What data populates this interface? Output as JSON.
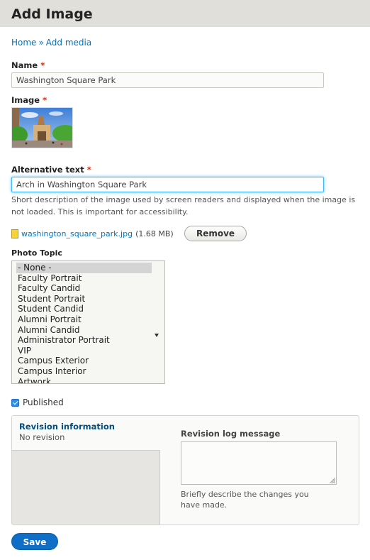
{
  "header": {
    "title": "Add Image"
  },
  "breadcrumb": {
    "items": [
      {
        "label": "Home"
      },
      {
        "label": "Add media"
      }
    ],
    "separator": "»"
  },
  "form": {
    "name": {
      "label": "Name",
      "required_mark": "*",
      "value": "Washington Square Park"
    },
    "image": {
      "label": "Image",
      "required_mark": "*",
      "thumbnail_alt": "Arch in Washington Square Park"
    },
    "alt_text": {
      "label": "Alternative text",
      "required_mark": "*",
      "value": "Arch in Washington Square Park",
      "description": "Short description of the image used by screen readers and displayed when the image is not loaded. This is important for accessibility."
    },
    "file": {
      "filename": "washington_square_park.jpg",
      "size": "(1.68 MB)",
      "remove_label": "Remove"
    },
    "photo_topic": {
      "label": "Photo Topic",
      "options": [
        "- None -",
        "Faculty Portrait",
        "Faculty Candid",
        "Student Portrait",
        "Student Candid",
        "Alumni Portrait",
        "Alumni Candid",
        "Administrator Portrait",
        "VIP",
        "Campus Exterior",
        "Campus Interior",
        "Artwork"
      ],
      "selected": "- None -"
    },
    "published": {
      "label": "Published",
      "checked": true
    },
    "revision": {
      "title": "Revision information",
      "summary": "No revision",
      "log_label": "Revision log message",
      "log_value": "",
      "log_description": "Briefly describe the changes you have made."
    },
    "save_label": "Save"
  },
  "colors": {
    "accent": "#0074bd",
    "primary_button": "#0f6fc6",
    "required": "#e32700",
    "header_bg": "#e0dfd9"
  }
}
